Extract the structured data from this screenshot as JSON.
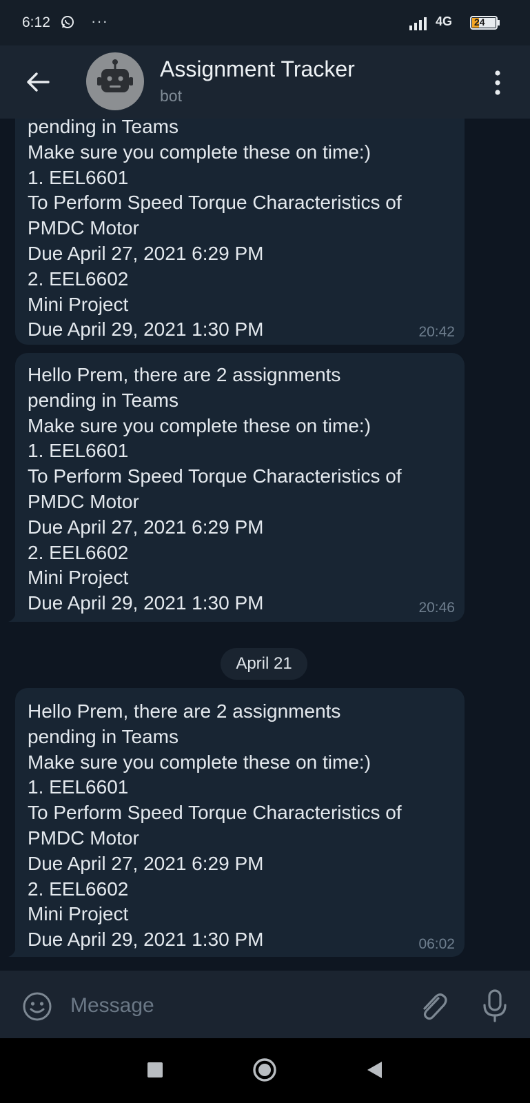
{
  "status_bar": {
    "time": "6:12",
    "dots": "···",
    "network": "4G",
    "battery": "24"
  },
  "header": {
    "title": "Assignment Tracker",
    "subtitle": "bot"
  },
  "messages": [
    {
      "text": "pending in Teams\nMake sure you complete these on time:)\n1. EEL6601\nTo Perform Speed Torque Characteristics of\nPMDC Motor\nDue April 27, 2021 6:29 PM\n2. EEL6602\nMini Project\nDue April 29, 2021 1:30 PM",
      "time": "20:42"
    },
    {
      "text": "Hello Prem, there are 2 assignments\npending in Teams\nMake sure you complete these on time:)\n1. EEL6601\nTo Perform Speed Torque Characteristics of\nPMDC Motor\nDue April 27, 2021 6:29 PM\n2. EEL6602\nMini Project\nDue April 29, 2021 1:30 PM",
      "time": "20:46"
    },
    {
      "text": "Hello Prem, there are 2 assignments\npending in Teams\nMake sure you complete these on time:)\n1. EEL6601\nTo Perform Speed Torque Characteristics of\nPMDC Motor\nDue April 27, 2021 6:29 PM\n2. EEL6602\nMini Project\nDue April 29, 2021 1:30 PM",
      "time": "06:02"
    }
  ],
  "date_separator": "April 21",
  "input": {
    "placeholder": "Message"
  },
  "colors": {
    "background": "#0e1621",
    "header": "#1b2531",
    "bubble": "#182533",
    "timestamp": "#6f7f8f"
  }
}
